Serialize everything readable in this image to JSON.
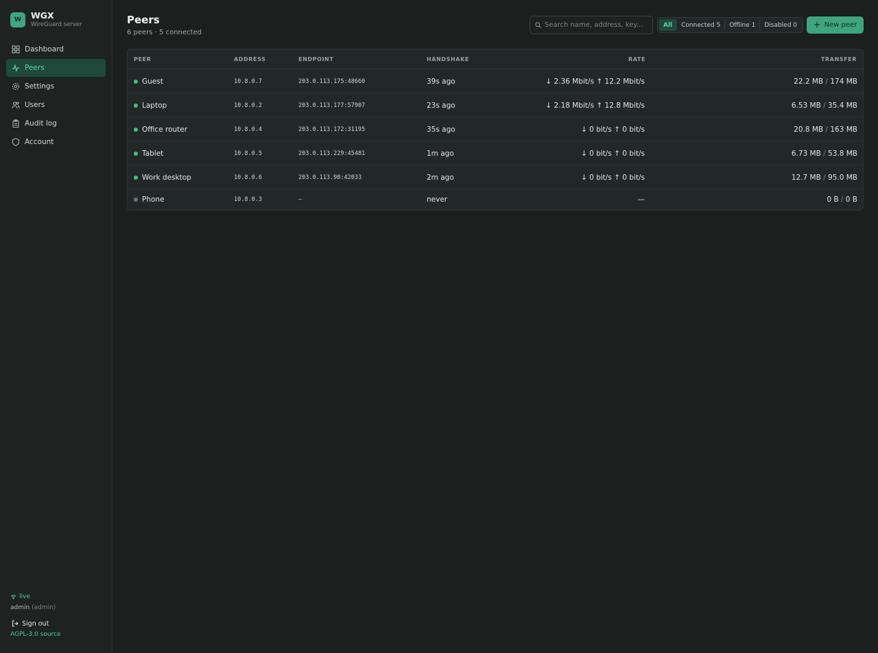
{
  "brand": {
    "logo_letter": "W",
    "name": "WGX",
    "subtitle": "WireGuard server"
  },
  "nav": [
    {
      "label": "Dashboard",
      "icon": "grid-icon",
      "active": false
    },
    {
      "label": "Peers",
      "icon": "activity-icon",
      "active": true
    },
    {
      "label": "Settings",
      "icon": "gear-icon",
      "active": false
    },
    {
      "label": "Users",
      "icon": "users-icon",
      "active": false
    },
    {
      "label": "Audit log",
      "icon": "clipboard-icon",
      "active": false
    },
    {
      "label": "Account",
      "icon": "shield-icon",
      "active": false
    }
  ],
  "sidebar_footer": {
    "live": "live",
    "user": "admin",
    "role": "(admin)",
    "signout": "Sign out",
    "source": "AGPL-3.0 source"
  },
  "header": {
    "title": "Peers",
    "subtitle": "6 peers · 5 connected",
    "search_placeholder": "Search name, address, key...",
    "filters": [
      {
        "label": "All",
        "active": true
      },
      {
        "label": "Connected 5",
        "active": false
      },
      {
        "label": "Offline 1",
        "active": false
      },
      {
        "label": "Disabled 0",
        "active": false
      }
    ],
    "new_peer": "New peer"
  },
  "table": {
    "columns": {
      "peer": "PEER",
      "address": "ADDRESS",
      "endpoint": "ENDPOINT",
      "handshake": "HANDSHAKE",
      "rate": "RATE",
      "transfer": "TRANSFER"
    },
    "rows": [
      {
        "name": "Guest",
        "status": "connected",
        "address": "10.8.0.7",
        "endpoint": "203.0.113.175:48660",
        "handshake": "39s ago",
        "rate": "↓ 2.36 Mbit/s ↑ 12.2 Mbit/s",
        "rx": "22.2 MB",
        "tx": "174 MB"
      },
      {
        "name": "Laptop",
        "status": "connected",
        "address": "10.8.0.2",
        "endpoint": "203.0.113.177:57907",
        "handshake": "23s ago",
        "rate": "↓ 2.18 Mbit/s ↑ 12.8 Mbit/s",
        "rx": "6.53 MB",
        "tx": "35.4 MB"
      },
      {
        "name": "Office router",
        "status": "connected",
        "address": "10.8.0.4",
        "endpoint": "203.0.113.172:31195",
        "handshake": "35s ago",
        "rate": "↓ 0 bit/s ↑ 0 bit/s",
        "rx": "20.8 MB",
        "tx": "163 MB"
      },
      {
        "name": "Tablet",
        "status": "connected",
        "address": "10.8.0.5",
        "endpoint": "203.0.113.229:45481",
        "handshake": "1m ago",
        "rate": "↓ 0 bit/s ↑ 0 bit/s",
        "rx": "6.73 MB",
        "tx": "53.8 MB"
      },
      {
        "name": "Work desktop",
        "status": "connected",
        "address": "10.8.0.6",
        "endpoint": "203.0.113.98:42033",
        "handshake": "2m ago",
        "rate": "↓ 0 bit/s ↑ 0 bit/s",
        "rx": "12.7 MB",
        "tx": "95.0 MB"
      },
      {
        "name": "Phone",
        "status": "offline",
        "address": "10.8.0.3",
        "endpoint": "–",
        "handshake": "never",
        "rate": "—",
        "rx": "0 B",
        "tx": "0 B"
      }
    ]
  },
  "colors": {
    "accent": "#3fa581",
    "connected": "#3ec27f",
    "offline": "#6f7674",
    "background": "#1b1f1e"
  }
}
